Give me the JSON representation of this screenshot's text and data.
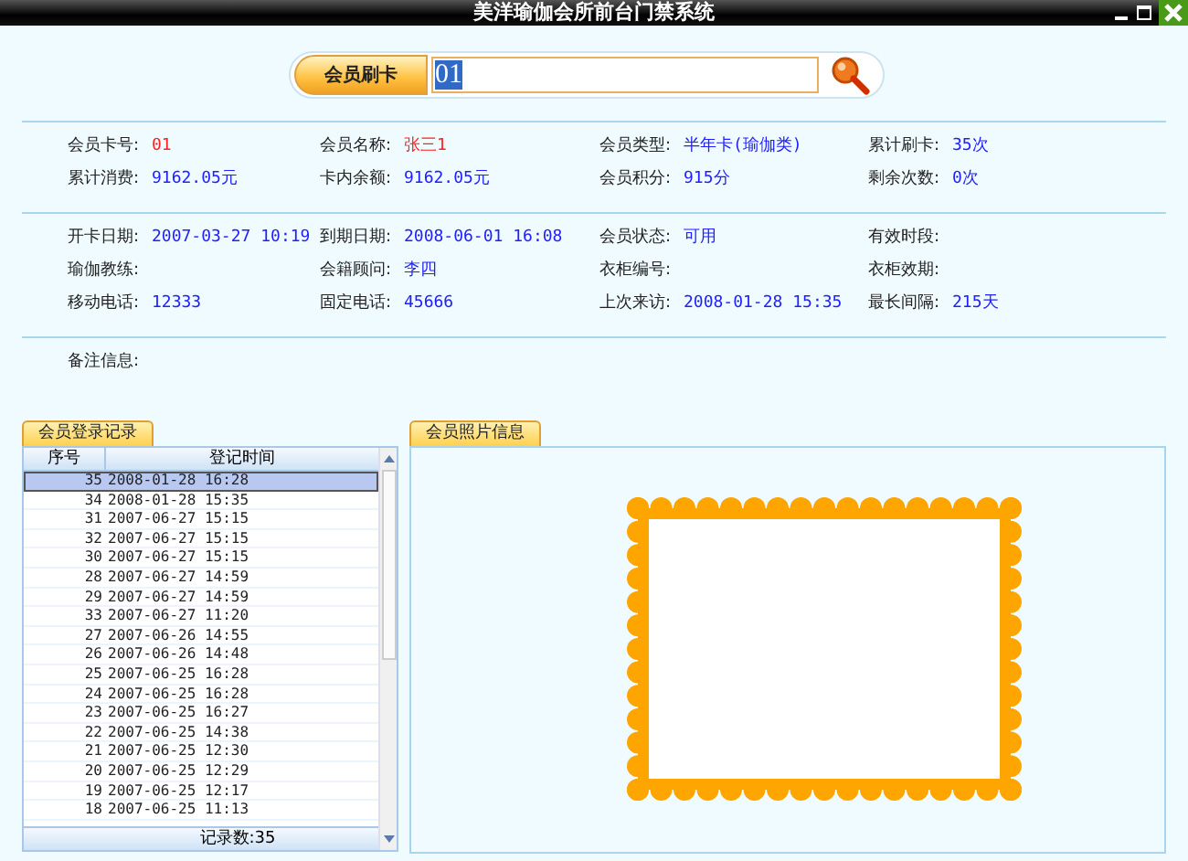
{
  "window": {
    "title": "美洋瑜伽会所前台门禁系统"
  },
  "search": {
    "button": "会员刷卡",
    "value": "01"
  },
  "sections": [
    [
      {
        "label": "会员卡号:",
        "value": "01",
        "highlight": true
      },
      {
        "label": "会员名称:",
        "value": "张三1",
        "highlight": true
      },
      {
        "label": "会员类型:",
        "value": "半年卡(瑜伽类)",
        "highlight": false
      },
      {
        "label": "累计刷卡:",
        "value": "35次",
        "highlight": false
      },
      {
        "label": "累计消费:",
        "value": "9162.05元",
        "highlight": false
      },
      {
        "label": "卡内余额:",
        "value": "9162.05元",
        "highlight": false
      },
      {
        "label": "会员积分:",
        "value": "915分",
        "highlight": false
      },
      {
        "label": "剩余次数:",
        "value": "0次",
        "highlight": false
      }
    ],
    [
      {
        "label": "开卡日期:",
        "value": "2007-03-27 10:19",
        "highlight": false
      },
      {
        "label": "到期日期:",
        "value": "2008-06-01 16:08",
        "highlight": false
      },
      {
        "label": "会员状态:",
        "value": "可用",
        "highlight": false
      },
      {
        "label": "有效时段:"
      },
      {
        "label": "瑜伽教练:"
      },
      {
        "label": "会籍顾问:",
        "value": "李四",
        "highlight": false
      },
      {
        "label": "衣柜编号:"
      },
      {
        "label": "衣柜效期:"
      },
      {
        "label": "移动电话:",
        "value": "12333",
        "highlight": false
      },
      {
        "label": "固定电话:",
        "value": "45666",
        "highlight": false
      },
      {
        "label": "上次来访:",
        "value": "2008-01-28 15:35",
        "highlight": false
      },
      {
        "label": "最长间隔:",
        "value": "215天",
        "highlight": false
      }
    ],
    [
      {
        "label": "备注信息:"
      }
    ]
  ],
  "log": {
    "tab": "会员登录记录",
    "columns": [
      "序号",
      "登记时间"
    ],
    "rows": [
      {
        "no": "35",
        "time": "2008-01-28 16:28",
        "selected": true
      },
      {
        "no": "34",
        "time": "2008-01-28 15:35",
        "selected": false
      },
      {
        "no": "31",
        "time": "2007-06-27 15:15",
        "selected": false
      },
      {
        "no": "32",
        "time": "2007-06-27 15:15",
        "selected": false
      },
      {
        "no": "30",
        "time": "2007-06-27 15:15",
        "selected": false
      },
      {
        "no": "28",
        "time": "2007-06-27 14:59",
        "selected": false
      },
      {
        "no": "29",
        "time": "2007-06-27 14:59",
        "selected": false
      },
      {
        "no": "33",
        "time": "2007-06-27 11:20",
        "selected": false
      },
      {
        "no": "27",
        "time": "2007-06-26 14:55",
        "selected": false
      },
      {
        "no": "26",
        "time": "2007-06-26 14:48",
        "selected": false
      },
      {
        "no": "25",
        "time": "2007-06-25 16:28",
        "selected": false
      },
      {
        "no": "24",
        "time": "2007-06-25 16:28",
        "selected": false
      },
      {
        "no": "23",
        "time": "2007-06-25 16:27",
        "selected": false
      },
      {
        "no": "22",
        "time": "2007-06-25 14:38",
        "selected": false
      },
      {
        "no": "21",
        "time": "2007-06-25 12:30",
        "selected": false
      },
      {
        "no": "20",
        "time": "2007-06-25 12:29",
        "selected": false
      },
      {
        "no": "19",
        "time": "2007-06-25 12:17",
        "selected": false
      },
      {
        "no": "18",
        "time": "2007-06-25 11:13",
        "selected": false
      }
    ],
    "footer": "记录数:35"
  },
  "photo": {
    "tab": "会员照片信息"
  }
}
